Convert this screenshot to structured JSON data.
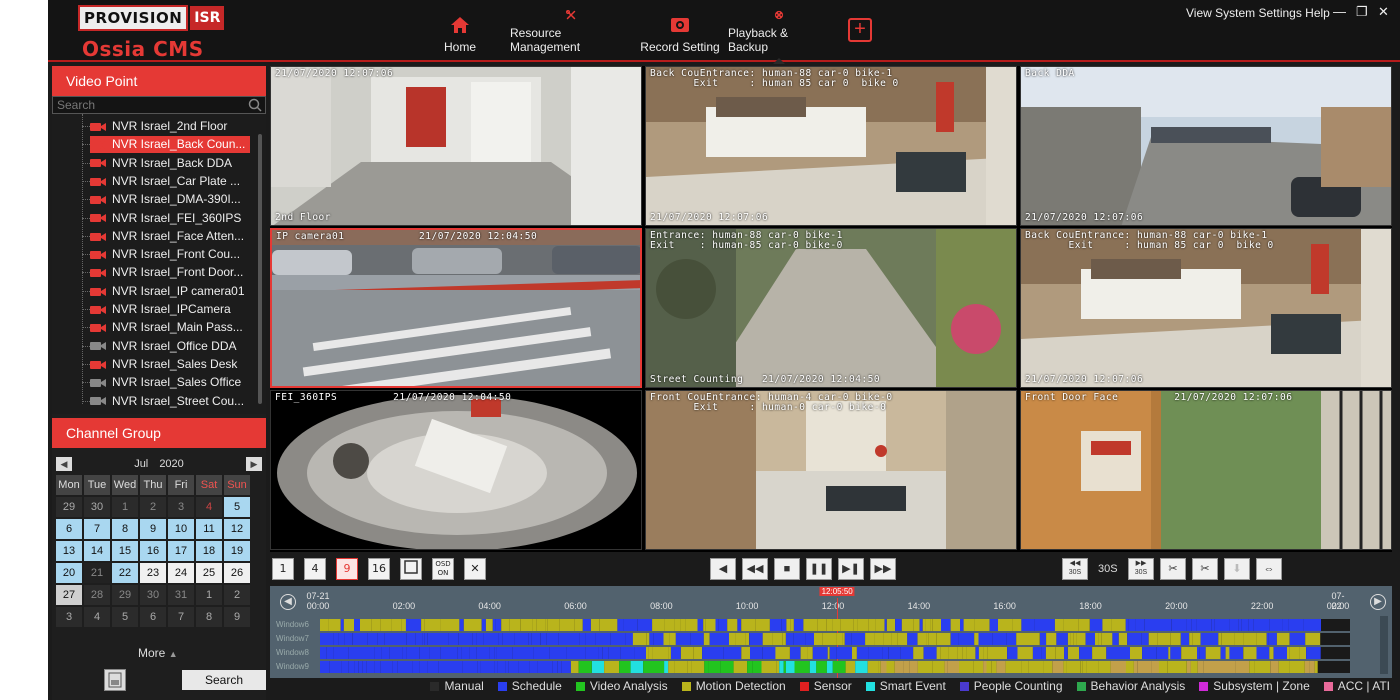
{
  "brand": {
    "logo_word": "PROVISION",
    "logo_suffix": "ISR",
    "product": "Ossia CMS"
  },
  "nav": [
    {
      "label": "Home",
      "icon": "home-icon"
    },
    {
      "label": "Resource Management",
      "icon": "tools-icon"
    },
    {
      "label": "Record Setting",
      "icon": "record-icon"
    },
    {
      "label": "Playback & Backup",
      "icon": "film-reel-icon",
      "active": true
    }
  ],
  "add_tab_icon": "plus-icon",
  "system_menu": "View  System  Settings  Help",
  "window_controls": {
    "minimize": "—",
    "restore": "❐",
    "close": "✕"
  },
  "left": {
    "video_point_title": "Video Point",
    "search_placeholder": "Search",
    "tree": [
      {
        "label": "NVR Israel_2nd Floor",
        "online": true
      },
      {
        "label": "NVR Israel_Back Coun...",
        "online": true,
        "selected": true
      },
      {
        "label": "NVR Israel_Back DDA",
        "online": true
      },
      {
        "label": "NVR Israel_Car Plate ...",
        "online": true
      },
      {
        "label": "NVR Israel_DMA-390I...",
        "online": true
      },
      {
        "label": "NVR Israel_FEI_360IPS",
        "online": true
      },
      {
        "label": "NVR Israel_Face Atten...",
        "online": true
      },
      {
        "label": "NVR Israel_Front Cou...",
        "online": true
      },
      {
        "label": "NVR Israel_Front Door...",
        "online": true
      },
      {
        "label": "NVR Israel_IP camera01",
        "online": true
      },
      {
        "label": "NVR Israel_IPCamera",
        "online": true
      },
      {
        "label": "NVR Israel_Main Pass...",
        "online": true
      },
      {
        "label": "NVR Israel_Office DDA",
        "online": false
      },
      {
        "label": "NVR Israel_Sales Desk",
        "online": true
      },
      {
        "label": "NVR Israel_Sales Office",
        "online": false
      },
      {
        "label": "NVR Israel_Street Cou...",
        "online": false
      }
    ],
    "channel_group_title": "Channel Group",
    "calendar": {
      "month": "Jul",
      "year": "2020",
      "weekdays": [
        "Mon",
        "Tue",
        "Wed",
        "Thu",
        "Fri",
        "Sat",
        "Sun"
      ],
      "weeks": [
        [
          {
            "d": "29",
            "s": "prev"
          },
          {
            "d": "30",
            "s": "prev"
          },
          {
            "d": "1",
            "s": "grey"
          },
          {
            "d": "2",
            "s": "grey"
          },
          {
            "d": "3",
            "s": "grey"
          },
          {
            "d": "4",
            "s": "grey"
          },
          {
            "d": "5",
            "s": "blue"
          }
        ],
        [
          {
            "d": "6",
            "s": "blue"
          },
          {
            "d": "7",
            "s": "blue"
          },
          {
            "d": "8",
            "s": "blue"
          },
          {
            "d": "9",
            "s": "blue"
          },
          {
            "d": "10",
            "s": "blue"
          },
          {
            "d": "11",
            "s": "blue"
          },
          {
            "d": "12",
            "s": "blue"
          }
        ],
        [
          {
            "d": "13",
            "s": "blue"
          },
          {
            "d": "14",
            "s": "blue"
          },
          {
            "d": "15",
            "s": "blue"
          },
          {
            "d": "16",
            "s": "blue"
          },
          {
            "d": "17",
            "s": "blue"
          },
          {
            "d": "18",
            "s": "blue"
          },
          {
            "d": "19",
            "s": "blue"
          }
        ],
        [
          {
            "d": "20",
            "s": "blue"
          },
          {
            "d": "21",
            "s": "dark"
          },
          {
            "d": "22",
            "s": "blue"
          },
          {
            "d": "23",
            "s": "white"
          },
          {
            "d": "24",
            "s": "white"
          },
          {
            "d": "25",
            "s": "white"
          },
          {
            "d": "26",
            "s": "white"
          }
        ],
        [
          {
            "d": "27",
            "s": "today"
          },
          {
            "d": "28",
            "s": "grey"
          },
          {
            "d": "29",
            "s": "grey"
          },
          {
            "d": "30",
            "s": "grey"
          },
          {
            "d": "31",
            "s": "grey"
          },
          {
            "d": "1",
            "s": "prev"
          },
          {
            "d": "2",
            "s": "prev"
          }
        ],
        [
          {
            "d": "3",
            "s": "prev"
          },
          {
            "d": "4",
            "s": "prev"
          },
          {
            "d": "5",
            "s": "prev"
          },
          {
            "d": "6",
            "s": "prev"
          },
          {
            "d": "7",
            "s": "prev"
          },
          {
            "d": "8",
            "s": "prev"
          },
          {
            "d": "9",
            "s": "prev"
          }
        ]
      ]
    },
    "more_label": "More",
    "search_button": "Search"
  },
  "tiles": [
    {
      "osd": [
        "21/07/2020 12:07:06"
      ],
      "osd_bottom": "2nd Floor",
      "scene": "corridor"
    },
    {
      "osd": [
        "Back CouEntrance: human-88 car-0 bike-1",
        "       Exit     : human 85 car 0  bike 0"
      ],
      "osd_bottom": "21/07/2020 12:07:06",
      "scene": "office"
    },
    {
      "osd": [
        "Back DDA"
      ],
      "osd_bottom": "21/07/2020 12:07:06",
      "scene": "parking"
    },
    {
      "osd": [
        "IP camera01            21/07/2020 12:04:50"
      ],
      "osd_bottom": "",
      "scene": "street",
      "selected": true
    },
    {
      "osd": [
        "Entrance: human-88 car-0 bike-1",
        "Exit    : human-85 car-0 bike-0"
      ],
      "osd_bottom": "Street Counting   21/07/2020 12:04:50",
      "scene": "path"
    },
    {
      "osd": [
        "Back CouEntrance: human-88 car-0 bike-1",
        "       Exit     : human 85 car 0  bike 0"
      ],
      "osd_bottom": "21/07/2020 12:07:06",
      "scene": "office"
    },
    {
      "osd": [
        "FEI_360IPS         21/07/2020 12:04:50"
      ],
      "osd_bottom": "",
      "scene": "fisheye"
    },
    {
      "osd": [
        "Front CouEntrance: human-4 car-0 bike-0",
        "       Exit     : human-0 car-0 bike-0"
      ],
      "osd_bottom": "",
      "scene": "lobby"
    },
    {
      "osd": [
        "Front Door Face         21/07/2020 12:07:06"
      ],
      "osd_bottom": "",
      "scene": "door"
    }
  ],
  "layout_buttons": [
    "1",
    "4",
    "9",
    "16"
  ],
  "layout_active": "9",
  "osd_button": [
    "OSD",
    "ON"
  ],
  "speed": {
    "back": "30S",
    "label": "30S",
    "fwd": "30S"
  },
  "timeline": {
    "start_date": "07-21",
    "start_time": "00:00",
    "end_date": "07-22",
    "end_time": "00:00",
    "ticks": [
      "02:00",
      "04:00",
      "06:00",
      "08:00",
      "10:00",
      "12:00",
      "14:00",
      "16:00",
      "18:00",
      "20:00",
      "22:00"
    ],
    "current": "12:05:50",
    "rows": [
      "Window6",
      "Window7",
      "Window8",
      "Window9"
    ]
  },
  "legend": [
    {
      "label": "Manual",
      "color": "#2a2a2a"
    },
    {
      "label": "Schedule",
      "color": "#2a3ef0"
    },
    {
      "label": "Video Analysis",
      "color": "#22c41f"
    },
    {
      "label": "Motion Detection",
      "color": "#b9b41c"
    },
    {
      "label": "Sensor",
      "color": "#e02020"
    },
    {
      "label": "Smart Event",
      "color": "#22e0e0"
    },
    {
      "label": "People Counting",
      "color": "#4a3ad0"
    },
    {
      "label": "Behavior Analysis",
      "color": "#2ea84e"
    },
    {
      "label": "Subsystem | Zone",
      "color": "#d02ad8"
    },
    {
      "label": "ACC | ATI",
      "color": "#e86a9a"
    }
  ]
}
